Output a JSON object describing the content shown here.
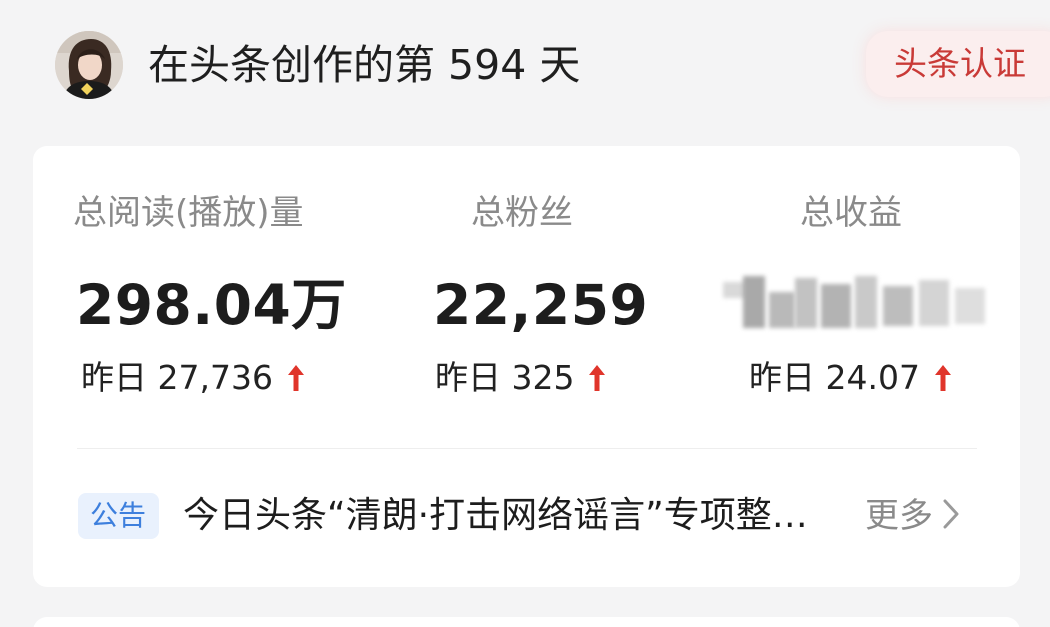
{
  "header": {
    "title": "在头条创作的第 594 天",
    "badge": "头条认证"
  },
  "stats": [
    {
      "label": "总阅读(播放)量",
      "value": "298.04万",
      "yesterday": "昨日 27,736",
      "trend": "up"
    },
    {
      "label": "总粉丝",
      "value": "22,259",
      "yesterday": "昨日 325",
      "trend": "up"
    },
    {
      "label": "总收益",
      "value": "",
      "value_hidden": true,
      "yesterday": "昨日 24.07",
      "trend": "up"
    }
  ],
  "notice": {
    "tag": "公告",
    "text": "今日头条“清朗·打击网络谣言”专项整…",
    "more": "更多"
  },
  "icons": {
    "avatar": "user-avatar-photo",
    "trend": "arrow-up-icon",
    "more": "chevron-right-icon"
  },
  "colors": {
    "background": "#f4f4f5",
    "card": "#ffffff",
    "badge_bg": "#fbeeee",
    "badge_text": "#c93a37",
    "trend_up": "#e0352b",
    "notice_tag_bg": "#e9f1fd",
    "notice_tag_text": "#3d7fdd",
    "muted_text": "#8a8a8a"
  }
}
